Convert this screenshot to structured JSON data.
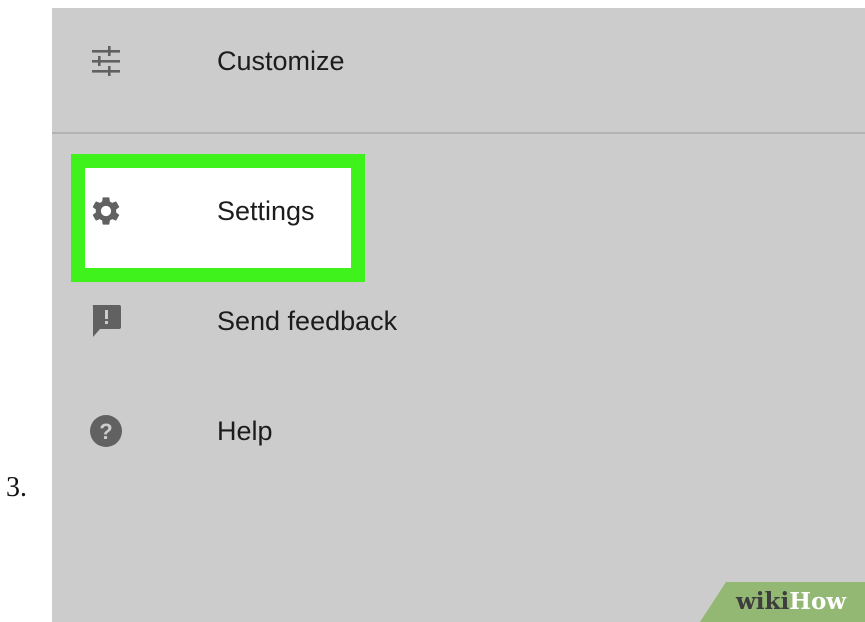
{
  "step": {
    "number": "3."
  },
  "menu": {
    "items": [
      {
        "label": "Customize",
        "icon": "sliders-icon"
      },
      {
        "label": "Settings",
        "icon": "gear-icon",
        "highlighted": true
      },
      {
        "label": "Send feedback",
        "icon": "feedback-icon"
      },
      {
        "label": "Help",
        "icon": "help-icon"
      }
    ]
  },
  "colors": {
    "panel_background": "#cccccc",
    "highlight": "#3ff21c",
    "icon": "#616161",
    "text": "#1c1c1c",
    "badge": "#93b874"
  },
  "watermark": {
    "wiki": "wiki",
    "how": "How"
  }
}
